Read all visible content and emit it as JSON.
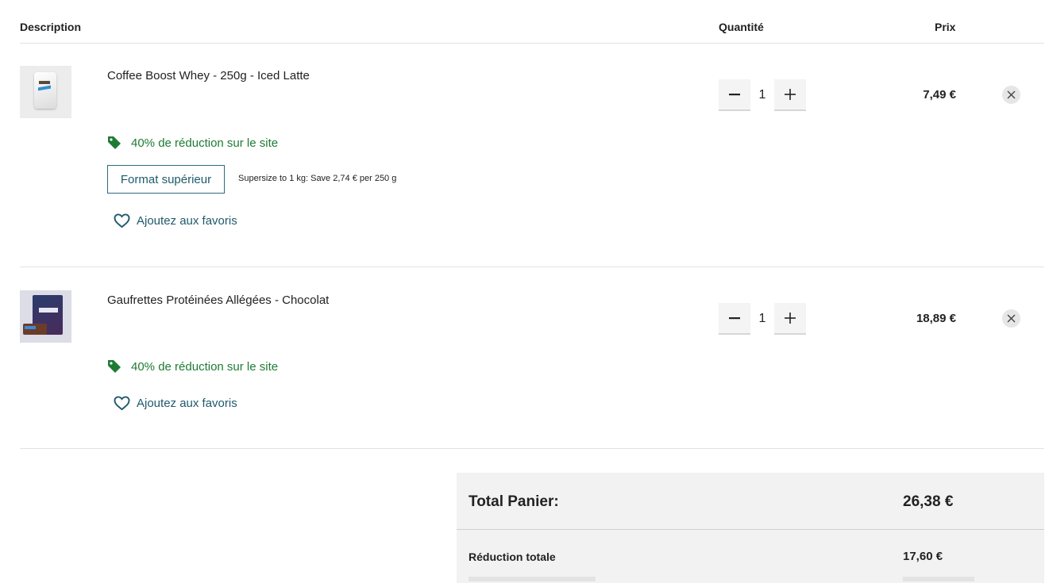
{
  "header": {
    "description": "Description",
    "quantity": "Quantité",
    "price": "Prix"
  },
  "items": [
    {
      "title": "Coffee Boost Whey - 250g - Iced Latte",
      "promo": "40% de réduction sur le site",
      "upsell_button": "Format supérieur",
      "upsell_note": "Supersize to 1 kg: Save 2,74 € per 250 g",
      "favorite": "Ajoutez aux favoris",
      "quantity": "1",
      "price": "7,49 €"
    },
    {
      "title": "Gaufrettes Protéinées Allégées - Chocolat",
      "promo": "40% de réduction sur le site",
      "favorite": "Ajoutez aux favoris",
      "quantity": "1",
      "price": "18,89 €"
    }
  ],
  "summary": {
    "total_label": "Total Panier:",
    "total_value": "26,38 €",
    "discount_label": "Réduction totale",
    "discount_value": "17,60 €"
  },
  "colors": {
    "promo_green": "#1e7b34",
    "link_teal": "#1f5a6b",
    "summary_bg": "#f2f2f2"
  },
  "icons": {
    "promo": "price-tag-icon",
    "favorite": "heart-outline-icon",
    "decrease": "minus-icon",
    "increase": "plus-icon",
    "remove": "close-icon"
  }
}
